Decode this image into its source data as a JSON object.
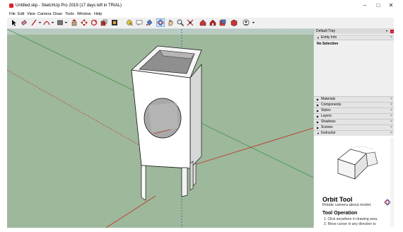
{
  "window": {
    "title": "Untitled.skp - SketchUp Pro 2019 (17 days left in TRIAL)",
    "minimize": "–",
    "maximize": "□",
    "close": "✕"
  },
  "menu": [
    "File",
    "Edit",
    "View",
    "Camera",
    "Draw",
    "Tools",
    "Window",
    "Help"
  ],
  "toolbar": {
    "tools": [
      {
        "name": "select-icon"
      },
      {
        "name": "eraser-icon"
      },
      {
        "name": "line-icon"
      },
      {
        "name": "arc-icon"
      },
      {
        "name": "rectangle-icon"
      },
      {
        "name": "push-pull-icon"
      },
      {
        "name": "move-icon"
      },
      {
        "name": "rotate-icon"
      },
      {
        "name": "scale-icon"
      },
      {
        "name": "offset-icon"
      },
      {
        "name": "tape-measure-icon"
      },
      {
        "name": "text-icon"
      },
      {
        "name": "paint-bucket-icon"
      },
      {
        "name": "orbit-icon"
      },
      {
        "name": "pan-icon"
      },
      {
        "name": "zoom-icon"
      },
      {
        "name": "zoom-extents-icon"
      },
      {
        "name": "warehouse-icon"
      },
      {
        "name": "extension-warehouse-icon"
      },
      {
        "name": "layout-icon"
      },
      {
        "name": "extension-manager-icon"
      },
      {
        "name": "user-account-icon"
      }
    ],
    "active_tool": "orbit-icon"
  },
  "tray": {
    "title": "Default Tray",
    "entity_info_label": "Entity Info",
    "entity_info_value": "No Selection",
    "panels": [
      "Materials",
      "Components",
      "Styles",
      "Layers",
      "Shadows",
      "Scenes"
    ],
    "instructor_label": "Instructor",
    "instructor": {
      "tool_name": "Orbit Tool",
      "description": "Rotate camera about model.",
      "operation_heading": "Tool Operation",
      "steps": [
        "1. Click anywhere in drawing area.",
        "2. Move cursor in any direction to"
      ]
    }
  },
  "colors": {
    "ground": "#9db89b",
    "sky_upper": "#bfd3e6",
    "model_face": "#ffffff",
    "model_shade": "#dcdcdc",
    "model_dark": "#9a9a9a",
    "edge": "#111111",
    "axis_red": "#c0392b",
    "axis_green": "#2e8b3a",
    "axis_blue": "#2c5fb8",
    "active_tool_bg": "#cce4f7"
  }
}
